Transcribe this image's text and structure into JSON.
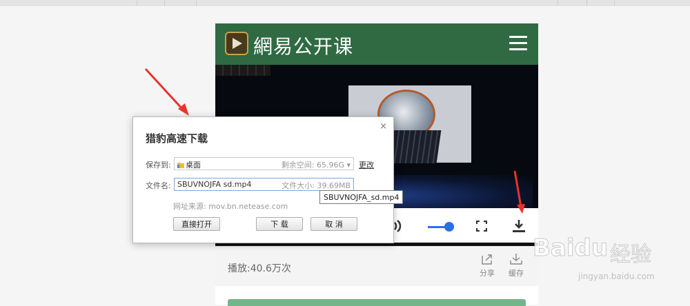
{
  "app": {
    "brand": "網易公开课"
  },
  "player": {
    "play_count": "播放:40.6万次",
    "actions": [
      {
        "label": "分享",
        "icon": "share-icon"
      },
      {
        "label": "缓存",
        "icon": "download-icon"
      }
    ],
    "volume_level": 0.8
  },
  "dialog": {
    "title": "猎豹高速下载",
    "close": "×",
    "save_label": "保存到:",
    "save_path": "桌面",
    "free_space": "剩余空间: 65.96G",
    "change": "更改",
    "filename_label": "文件名:",
    "filename": "SBUVNOJFA sd.mp4",
    "filesize": "文件大小: 39.69MB",
    "source": "网址来源: mov.bn.netease.com",
    "buttons": {
      "open": "直接打开",
      "download": "下 载",
      "cancel": "取 消"
    }
  },
  "tooltip": "SBUVNOJFA_sd.mp4",
  "watermark": {
    "logo": "Baidu",
    "cn": "经验",
    "url": "jingyan.baidu.com"
  },
  "colors": {
    "header_green": "#2f6a43",
    "accent_blue": "#2c6ee8",
    "annotation_red": "#e8332a"
  }
}
